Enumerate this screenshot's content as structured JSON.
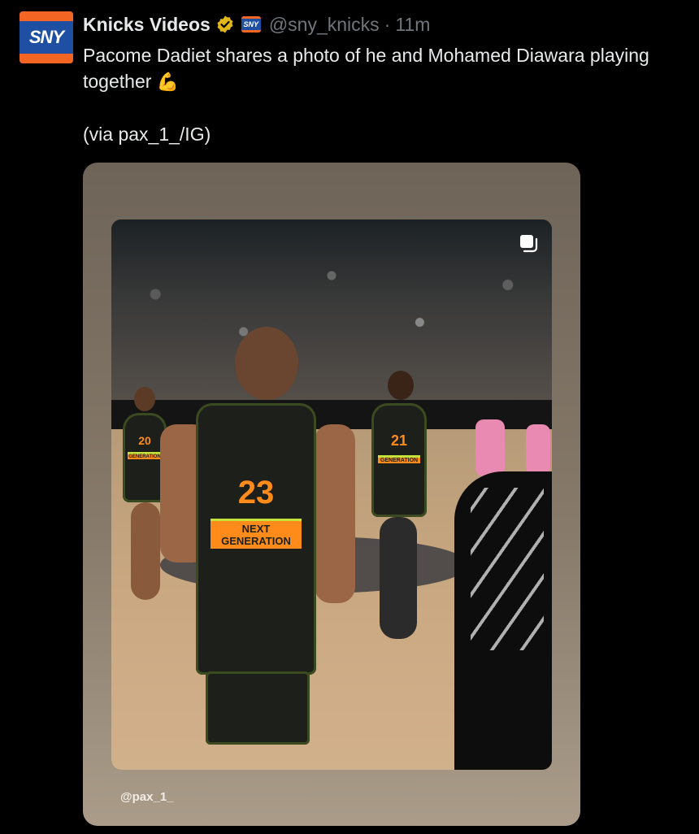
{
  "tweet": {
    "author": {
      "display_name": "Knicks Videos",
      "handle": "@sny_knicks",
      "avatar_icon": "sny-logo-icon",
      "avatar_text": "SNY",
      "verified_icon": "verified-gold-badge-icon",
      "affiliate_badge_text": "SNY"
    },
    "separator": "·",
    "time": "11m",
    "text": "Pacome Dadiet shares a photo of he and Mohamed Diawara playing together",
    "emoji": "💪",
    "via": "(via pax_1_/IG)"
  },
  "media": {
    "multi_image_icon": "multiple-images-icon",
    "photo_players": [
      {
        "number": "20",
        "jersey_text": "GENERATION"
      },
      {
        "number": "23",
        "jersey_text": "NEXT GENERATION"
      },
      {
        "number": "21",
        "jersey_text": "GENERATION"
      }
    ],
    "ig_handle": "@pax_1_"
  },
  "colors": {
    "background": "#000000",
    "text": "#e7e9ea",
    "muted": "#71767b",
    "verified_gold": "#e2b719",
    "sny_blue": "#1f4fa3",
    "sny_orange": "#f26522"
  }
}
